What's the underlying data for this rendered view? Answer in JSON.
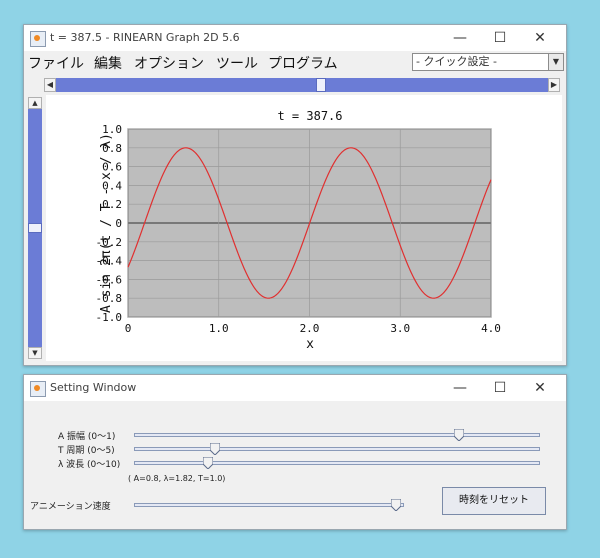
{
  "graph_window": {
    "title": "t = 387.5 - RINEARN Graph 2D 5.6",
    "menus": [
      "ファイル",
      "編集",
      "オプション",
      "ツール",
      "プログラム"
    ],
    "quick_settings": "- クイック設定 -",
    "minimize": "—",
    "maximize": "☐",
    "close": "✕"
  },
  "chart_data": {
    "type": "line",
    "title": "t = 387.6",
    "xlabel": "x",
    "ylabel": "A sin 2π(t / T - x / λ)",
    "xlim": [
      0,
      4.0
    ],
    "ylim": [
      -1.0,
      1.0
    ],
    "x_ticks": [
      "0",
      "1.0",
      "2.0",
      "3.0",
      "4.0"
    ],
    "y_ticks": [
      "1.0",
      "0.8",
      "0.6",
      "0.4",
      "0.2",
      "0",
      "-0.2",
      "-0.4",
      "-0.6",
      "-0.8",
      "-1.0"
    ],
    "grid": true,
    "series": [
      {
        "color": "#e03030",
        "amplitude": 0.8,
        "wavelength": 1.82,
        "period": 1.0,
        "t": 387.6
      }
    ],
    "plot_background": "#bdbdbd"
  },
  "setting_window": {
    "title": "Setting Window",
    "sliders": [
      {
        "label": "A 振幅 (0〜1)",
        "value": 0.8,
        "min": 0,
        "max": 1
      },
      {
        "label": "T 周期 (0〜5)",
        "value": 1.0,
        "min": 0,
        "max": 5
      },
      {
        "label": "λ 波長 (0〜10)",
        "value": 1.82,
        "min": 0,
        "max": 10
      }
    ],
    "params_text": "( A=0.8, λ=1.82, T=1.0)",
    "animation_label": "アニメーション速度",
    "animation_speed": 0.97,
    "reset_button": "時刻をリセット"
  }
}
